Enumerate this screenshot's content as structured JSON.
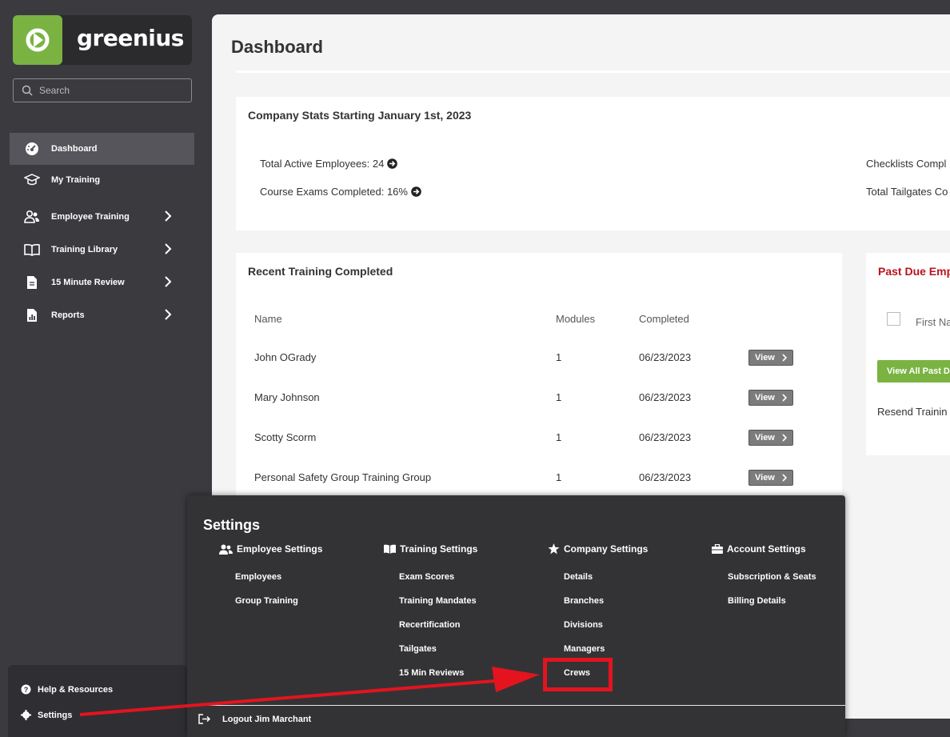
{
  "brand": {
    "name": "greenius",
    "accent": "#7ab342"
  },
  "search": {
    "placeholder": "Search"
  },
  "sidebar": {
    "items": [
      {
        "label": "Dashboard",
        "icon": "dashboard-gauge-icon",
        "active": true
      },
      {
        "label": "My Training",
        "icon": "graduation-cap-icon"
      },
      {
        "label": "Employee Training",
        "icon": "users-icon",
        "has_children": true
      },
      {
        "label": "Training Library",
        "icon": "open-book-icon",
        "has_children": true
      },
      {
        "label": "15 Minute Review",
        "icon": "document-icon",
        "has_children": true
      },
      {
        "label": "Reports",
        "icon": "report-chart-icon",
        "has_children": true
      }
    ],
    "help_label": "Help & Resources",
    "settings_label": "Settings"
  },
  "page": {
    "title": "Dashboard"
  },
  "company_stats": {
    "title": "Company Stats Starting January 1st, 2023",
    "total_active_employees": "Total Active Employees: 24",
    "course_exams_completed": "Course Exams Completed: 16%",
    "checklists_completed": "Checklists Compl",
    "total_tailgates": "Total Tailgates Co"
  },
  "recent_training": {
    "title": "Recent Training Completed",
    "columns": [
      "Name",
      "Modules",
      "Completed"
    ],
    "rows": [
      {
        "name": "John OGrady",
        "modules": "1",
        "completed": "06/23/2023",
        "action": "View"
      },
      {
        "name": "Mary Johnson",
        "modules": "1",
        "completed": "06/23/2023",
        "action": "View"
      },
      {
        "name": "Scotty Scorm",
        "modules": "1",
        "completed": "06/23/2023",
        "action": "View"
      },
      {
        "name": "Personal Safety Group Training Group",
        "modules": "1",
        "completed": "06/23/2023",
        "action": "View"
      }
    ]
  },
  "past_due": {
    "title": "Past Due Emp",
    "first_name_header": "First Na",
    "view_all_label": "View All Past D",
    "resend_label": "Resend Trainin"
  },
  "settings_menu": {
    "title": "Settings",
    "columns": [
      {
        "heading": "Employee Settings",
        "icon": "users-icon",
        "items": [
          "Employees",
          "Group Training"
        ]
      },
      {
        "heading": "Training Settings",
        "icon": "open-book-icon",
        "items": [
          "Exam Scores",
          "Training Mandates",
          "Recertification",
          "Tailgates",
          "15 Min Reviews"
        ]
      },
      {
        "heading": "Company Settings",
        "icon": "star-icon",
        "items": [
          "Details",
          "Branches",
          "Divisions",
          "Managers",
          "Crews"
        ]
      },
      {
        "heading": "Account Settings",
        "icon": "briefcase-icon",
        "items": [
          "Subscription & Seats",
          "Billing Details"
        ]
      }
    ],
    "logout_label": "Logout Jim Marchant",
    "highlight_color": "#e3141e"
  }
}
